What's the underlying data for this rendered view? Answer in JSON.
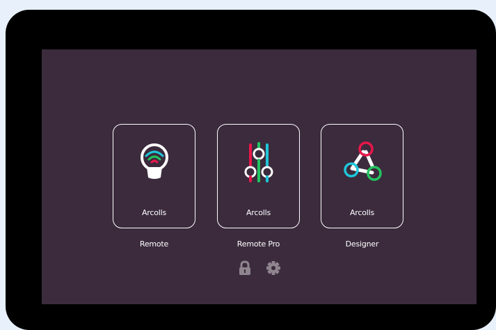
{
  "apps": [
    {
      "name_line1": "Arcolls",
      "name_line2": "Remote",
      "icon": "wifi-bulb-icon"
    },
    {
      "name_line1": "Arcolls",
      "name_line2": "Remote Pro",
      "icon": "sliders-icon"
    },
    {
      "name_line1": "Arcolls",
      "name_line2": "Designer",
      "icon": "triangle-nodes-icon"
    }
  ],
  "bottom_controls": {
    "lock_icon": "lock-icon",
    "settings_icon": "gear-icon"
  },
  "colors": {
    "screen_bg": "#3b2b3d",
    "bezel": "#000000",
    "page_bg": "#e8f1fb",
    "red": "#e8174a",
    "cyan": "#1ec7d9",
    "green": "#22c55e",
    "white": "#ffffff",
    "muted_icon": "#8f858f"
  }
}
